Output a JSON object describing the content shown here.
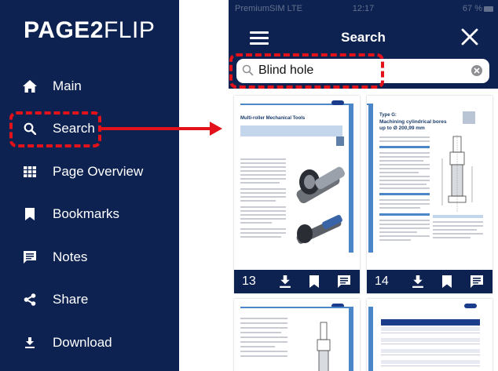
{
  "menu": {
    "logo_bold": "PAGE2",
    "logo_light": "FLIP",
    "items": [
      {
        "label": "Main",
        "icon": "home-icon"
      },
      {
        "label": "Search",
        "icon": "search-icon"
      },
      {
        "label": "Page Overview",
        "icon": "grid-icon"
      },
      {
        "label": "Bookmarks",
        "icon": "bookmark-icon"
      },
      {
        "label": "Notes",
        "icon": "notes-icon"
      },
      {
        "label": "Share",
        "icon": "share-icon"
      },
      {
        "label": "Download",
        "icon": "download-icon"
      }
    ]
  },
  "phone": {
    "status": {
      "carrier": "PremiumSIM  LTE",
      "time": "12:17",
      "battery": "67 %"
    },
    "title": "Search",
    "search": {
      "value": "Blind hole",
      "placeholder": ""
    },
    "results": [
      {
        "page": "13",
        "doc_title": "Multi-roller Mechanical Tools"
      },
      {
        "page": "14",
        "doc_title": "Type G:",
        "doc_subtitle": "Machining cylindrical bores",
        "doc_subtitle2": "up to Ø 200,99 mm"
      },
      {
        "page": "",
        "doc_title": ""
      },
      {
        "page": "",
        "doc_title": ""
      }
    ]
  },
  "colors": {
    "navy": "#0d2250",
    "highlight": "#e3111a",
    "accent_blue": "#4a86c8"
  }
}
